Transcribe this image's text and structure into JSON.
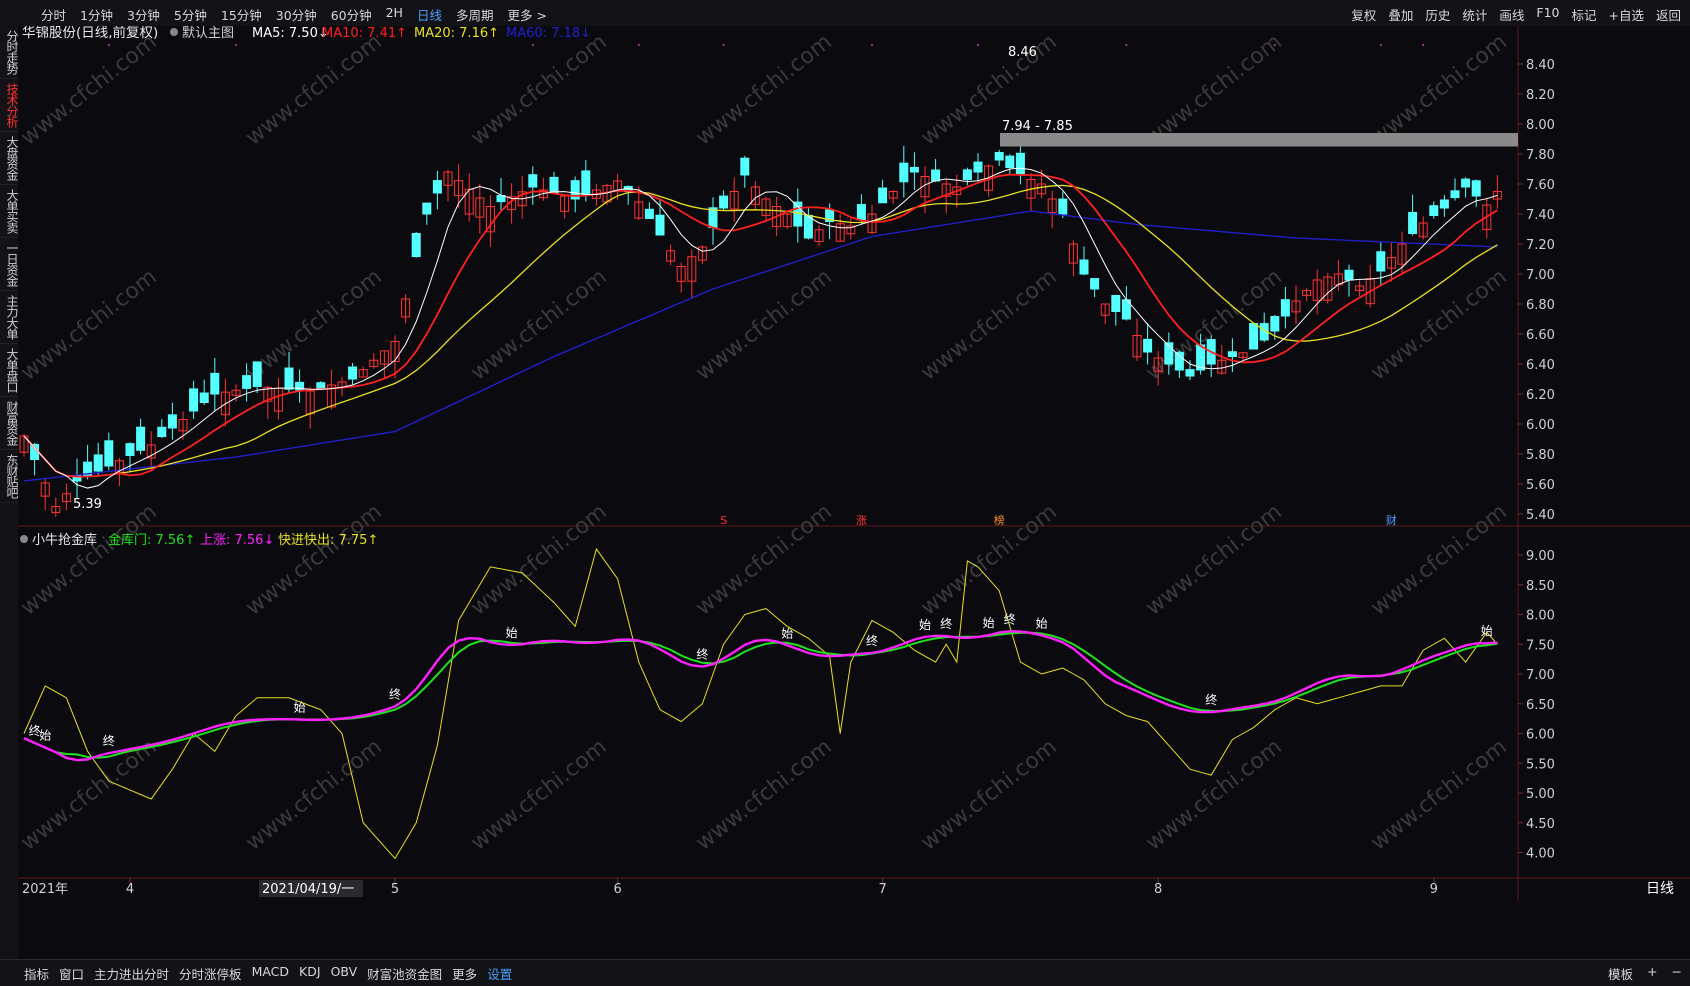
{
  "toolbar": {
    "left": [
      {
        "label": "分时"
      },
      {
        "label": "1分钟"
      },
      {
        "label": "3分钟"
      },
      {
        "label": "5分钟"
      },
      {
        "label": "15分钟"
      },
      {
        "label": "30分钟"
      },
      {
        "label": "60分钟"
      },
      {
        "label": "2H"
      },
      {
        "label": "日线",
        "active": true
      },
      {
        "label": "多周期"
      },
      {
        "label": "更多 >"
      }
    ],
    "right": [
      {
        "label": "复权"
      },
      {
        "label": "叠加"
      },
      {
        "label": "历史"
      },
      {
        "label": "统计"
      },
      {
        "label": "画线"
      },
      {
        "label": "F10"
      },
      {
        "label": "标记"
      },
      {
        "label": "+自选"
      },
      {
        "label": "返回"
      }
    ]
  },
  "side_tabs": [
    {
      "label": "分时走势",
      "active": false
    },
    {
      "label": "技术分析",
      "active": true
    },
    {
      "label": "大盘资金",
      "active": false
    },
    {
      "label": "大单买卖",
      "active": false
    },
    {
      "label": "一日资金",
      "active": false
    },
    {
      "label": "主力大单",
      "active": false
    },
    {
      "label": "大单盘口",
      "active": false
    },
    {
      "label": "财富资金",
      "active": false
    },
    {
      "label": "东财贴吧",
      "active": false
    }
  ],
  "main_legend": {
    "stock": "华锦股份(日线,前复权)",
    "template": "默认主图",
    "ma5": "MA5: 7.50↓",
    "ma10": "MA10: 7.41↑",
    "ma20": "MA20: 7.16↑",
    "ma60": "MA60: 7.18↓"
  },
  "sub_legend": {
    "name": "小牛抢金库",
    "gold": "金库门: 7.56↑",
    "up": "上涨: 7.56↓",
    "fast": "快进快出: 7.75↑"
  },
  "annotations": {
    "high": "8.46",
    "low": "5.39",
    "zone": "7.94 - 7.85"
  },
  "event_markers": [
    {
      "label": "S",
      "color": "#ff3030"
    },
    {
      "label": "涨",
      "color": "#ff3030"
    },
    {
      "label": "榜",
      "color": "#ff9020"
    },
    {
      "label": "财",
      "color": "#4aa0ff"
    }
  ],
  "date_labels": {
    "start": "2021年",
    "months": [
      "4",
      "5",
      "6",
      "7",
      "8",
      "9"
    ],
    "cursor": "2021/04/19/一",
    "period": "日线"
  },
  "signals": {
    "start": "始",
    "end": "终"
  },
  "watermark": "www.cfchi.com",
  "bottombar": {
    "left": [
      {
        "label": "指标"
      },
      {
        "label": "窗口"
      },
      {
        "label": "主力进出分时"
      },
      {
        "label": "分时涨停板"
      },
      {
        "label": "MACD"
      },
      {
        "label": "KDJ"
      },
      {
        "label": "OBV"
      },
      {
        "label": "财富池资金图"
      },
      {
        "label": "更多"
      },
      {
        "label": "设置",
        "active": true
      }
    ],
    "right": [
      {
        "label": "模板"
      },
      {
        "label": "+"
      },
      {
        "label": "−"
      }
    ]
  },
  "colors": {
    "up": "#ff3333",
    "down": "#54ffff",
    "ma5": "#ffffff",
    "ma10": "#ff2020",
    "ma20": "#e8e020",
    "ma60": "#2020d0",
    "gold": "#20e020",
    "rise": "#ff20ff",
    "fast": "#e8e020"
  },
  "chart_data": {
    "type": "candlestick",
    "price_axis": {
      "ticks": [
        "8.40",
        "8.20",
        "8.00",
        "7.80",
        "7.60",
        "7.40",
        "7.20",
        "7.00",
        "6.80",
        "6.60",
        "6.40",
        "6.20",
        "6.00",
        "5.80",
        "5.60",
        "5.40"
      ],
      "range": [
        5.3,
        8.55
      ]
    },
    "indicator_axis": {
      "ticks": [
        "9.00",
        "8.50",
        "8.00",
        "7.50",
        "7.00",
        "6.50",
        "6.00",
        "5.50",
        "5.00",
        "4.50",
        "4.00"
      ],
      "range": [
        3.75,
        9.2
      ]
    },
    "anchors": [
      [
        0,
        5.92
      ],
      [
        3,
        5.45
      ],
      [
        5,
        5.62
      ],
      [
        8,
        5.72
      ],
      [
        12,
        5.86
      ],
      [
        18,
        6.2
      ],
      [
        22,
        6.25
      ],
      [
        27,
        6.22
      ],
      [
        31,
        6.3
      ],
      [
        35,
        6.55
      ],
      [
        38,
        7.4
      ],
      [
        40,
        7.68
      ],
      [
        44,
        7.45
      ],
      [
        48,
        7.58
      ],
      [
        52,
        7.5
      ],
      [
        56,
        7.62
      ],
      [
        58,
        7.48
      ],
      [
        60,
        7.26
      ],
      [
        62,
        7.05
      ],
      [
        64,
        7.18
      ],
      [
        66,
        7.44
      ],
      [
        68,
        7.66
      ],
      [
        70,
        7.5
      ],
      [
        72,
        7.4
      ],
      [
        74,
        7.24
      ],
      [
        76,
        7.35
      ],
      [
        78,
        7.32
      ],
      [
        80,
        7.4
      ],
      [
        82,
        7.55
      ],
      [
        84,
        7.68
      ],
      [
        86,
        7.62
      ],
      [
        88,
        7.58
      ],
      [
        90,
        7.68
      ],
      [
        92,
        7.76
      ],
      [
        94,
        7.66
      ],
      [
        96,
        7.6
      ],
      [
        98,
        7.4
      ],
      [
        100,
        7.0
      ],
      [
        102,
        6.8
      ],
      [
        104,
        6.7
      ],
      [
        106,
        6.48
      ],
      [
        108,
        6.4
      ],
      [
        110,
        6.32
      ],
      [
        112,
        6.4
      ],
      [
        114,
        6.45
      ],
      [
        116,
        6.5
      ],
      [
        118,
        6.62
      ],
      [
        120,
        6.82
      ],
      [
        122,
        6.96
      ],
      [
        124,
        7.0
      ],
      [
        126,
        6.92
      ],
      [
        128,
        7.02
      ],
      [
        130,
        7.2
      ],
      [
        132,
        7.34
      ],
      [
        134,
        7.44
      ],
      [
        136,
        7.58
      ],
      [
        138,
        7.46
      ],
      [
        139,
        7.55
      ]
    ],
    "ma60_anchors": [
      [
        0,
        5.62
      ],
      [
        20,
        5.78
      ],
      [
        35,
        5.95
      ],
      [
        50,
        6.45
      ],
      [
        65,
        6.9
      ],
      [
        80,
        7.25
      ],
      [
        95,
        7.42
      ],
      [
        105,
        7.33
      ],
      [
        120,
        7.24
      ],
      [
        139,
        7.18
      ]
    ],
    "fast_anchors": [
      [
        0,
        6.0
      ],
      [
        2,
        6.8
      ],
      [
        4,
        6.6
      ],
      [
        6,
        5.7
      ],
      [
        8,
        5.2
      ],
      [
        12,
        4.9
      ],
      [
        14,
        5.4
      ],
      [
        16,
        6.0
      ],
      [
        18,
        5.7
      ],
      [
        20,
        6.3
      ],
      [
        22,
        6.6
      ],
      [
        25,
        6.6
      ],
      [
        28,
        6.4
      ],
      [
        30,
        6.0
      ],
      [
        32,
        4.5
      ],
      [
        35,
        3.9
      ],
      [
        37,
        4.5
      ],
      [
        39,
        5.8
      ],
      [
        41,
        7.9
      ],
      [
        44,
        8.8
      ],
      [
        47,
        8.7
      ],
      [
        50,
        8.2
      ],
      [
        52,
        7.8
      ],
      [
        54,
        9.1
      ],
      [
        56,
        8.6
      ],
      [
        58,
        7.2
      ],
      [
        60,
        6.4
      ],
      [
        62,
        6.2
      ],
      [
        64,
        6.5
      ],
      [
        66,
        7.5
      ],
      [
        68,
        8.0
      ],
      [
        70,
        8.1
      ],
      [
        72,
        7.8
      ],
      [
        74,
        7.6
      ],
      [
        76,
        7.3
      ],
      [
        77,
        6.0
      ],
      [
        78,
        7.2
      ],
      [
        80,
        7.9
      ],
      [
        82,
        7.7
      ],
      [
        84,
        7.4
      ],
      [
        86,
        7.2
      ],
      [
        87,
        7.5
      ],
      [
        88,
        7.2
      ],
      [
        89,
        8.9
      ],
      [
        90,
        8.8
      ],
      [
        92,
        8.4
      ],
      [
        94,
        7.2
      ],
      [
        96,
        7.0
      ],
      [
        98,
        7.1
      ],
      [
        100,
        6.9
      ],
      [
        102,
        6.5
      ],
      [
        104,
        6.3
      ],
      [
        106,
        6.2
      ],
      [
        108,
        5.8
      ],
      [
        110,
        5.4
      ],
      [
        112,
        5.3
      ],
      [
        114,
        5.9
      ],
      [
        116,
        6.1
      ],
      [
        118,
        6.4
      ],
      [
        120,
        6.6
      ],
      [
        122,
        6.5
      ],
      [
        124,
        6.6
      ],
      [
        126,
        6.7
      ],
      [
        128,
        6.8
      ],
      [
        130,
        6.8
      ],
      [
        132,
        7.4
      ],
      [
        134,
        7.6
      ],
      [
        136,
        7.2
      ],
      [
        138,
        7.7
      ],
      [
        139,
        7.5
      ]
    ]
  }
}
